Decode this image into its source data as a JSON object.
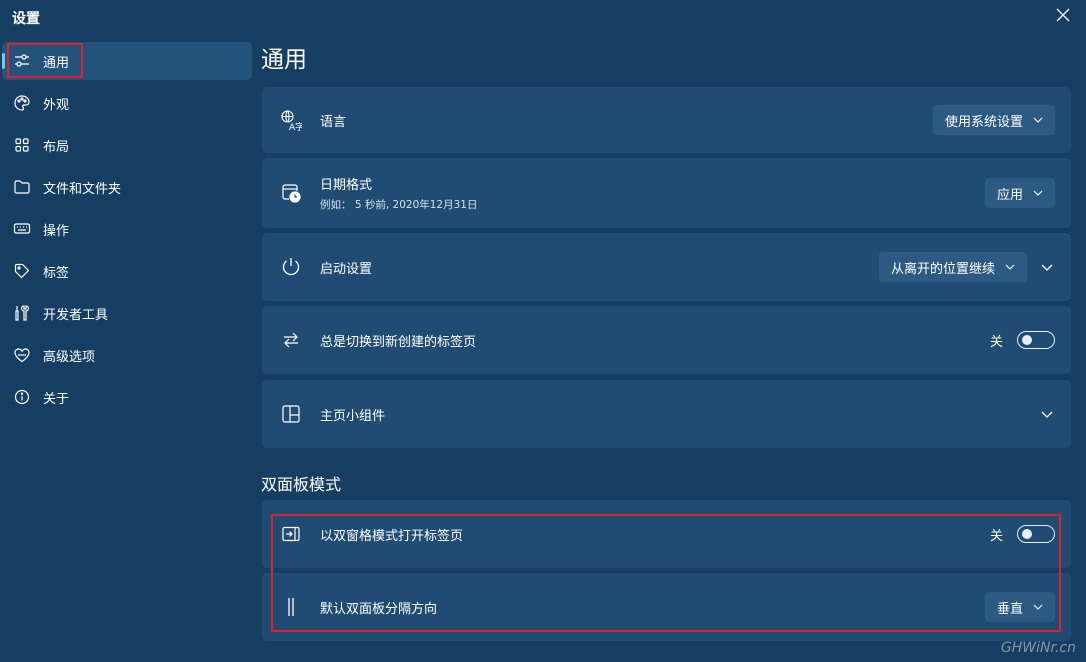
{
  "window": {
    "title": "设置"
  },
  "sidebar": {
    "items": [
      {
        "label": "通用",
        "icon": "sliders-icon",
        "active": true
      },
      {
        "label": "外观",
        "icon": "palette-icon"
      },
      {
        "label": "布局",
        "icon": "grid-icon"
      },
      {
        "label": "文件和文件夹",
        "icon": "folder-icon"
      },
      {
        "label": "操作",
        "icon": "keyboard-icon"
      },
      {
        "label": "标签",
        "icon": "tag-icon"
      },
      {
        "label": "开发者工具",
        "icon": "tools-icon"
      },
      {
        "label": "高级选项",
        "icon": "advanced-icon"
      },
      {
        "label": "关于",
        "icon": "info-icon"
      }
    ]
  },
  "main": {
    "title": "通用",
    "settings": {
      "language": {
        "label": "语言",
        "value": "使用系统设置",
        "icon": "language-icon"
      },
      "date_format": {
        "label": "日期格式",
        "example": "例如： 5 秒前, 2020年12月31日",
        "value": "应用",
        "icon": "calendar-clock-icon"
      },
      "startup": {
        "label": "启动设置",
        "value": "从离开的位置继续",
        "icon": "power-icon"
      },
      "switch_tab": {
        "label": "总是切换到新创建的标签页",
        "state": "关",
        "on": false,
        "icon": "switch-arrows-icon"
      },
      "widgets": {
        "label": "主页小组件",
        "icon": "widgets-icon"
      }
    },
    "dual_pane": {
      "title": "双面板模式",
      "open_dual": {
        "label": "以双窗格模式打开标签页",
        "state": "关",
        "on": false,
        "icon": "open-pane-icon"
      },
      "split_direction": {
        "label": "默认双面板分隔方向",
        "value": "垂直",
        "icon": "vertical-split-icon"
      }
    }
  },
  "watermark": "GHWiNr.cn",
  "colors": {
    "background": "#163e63",
    "card": "#204c74",
    "accent": "#6cc7f5",
    "highlight": "#d9242c"
  }
}
